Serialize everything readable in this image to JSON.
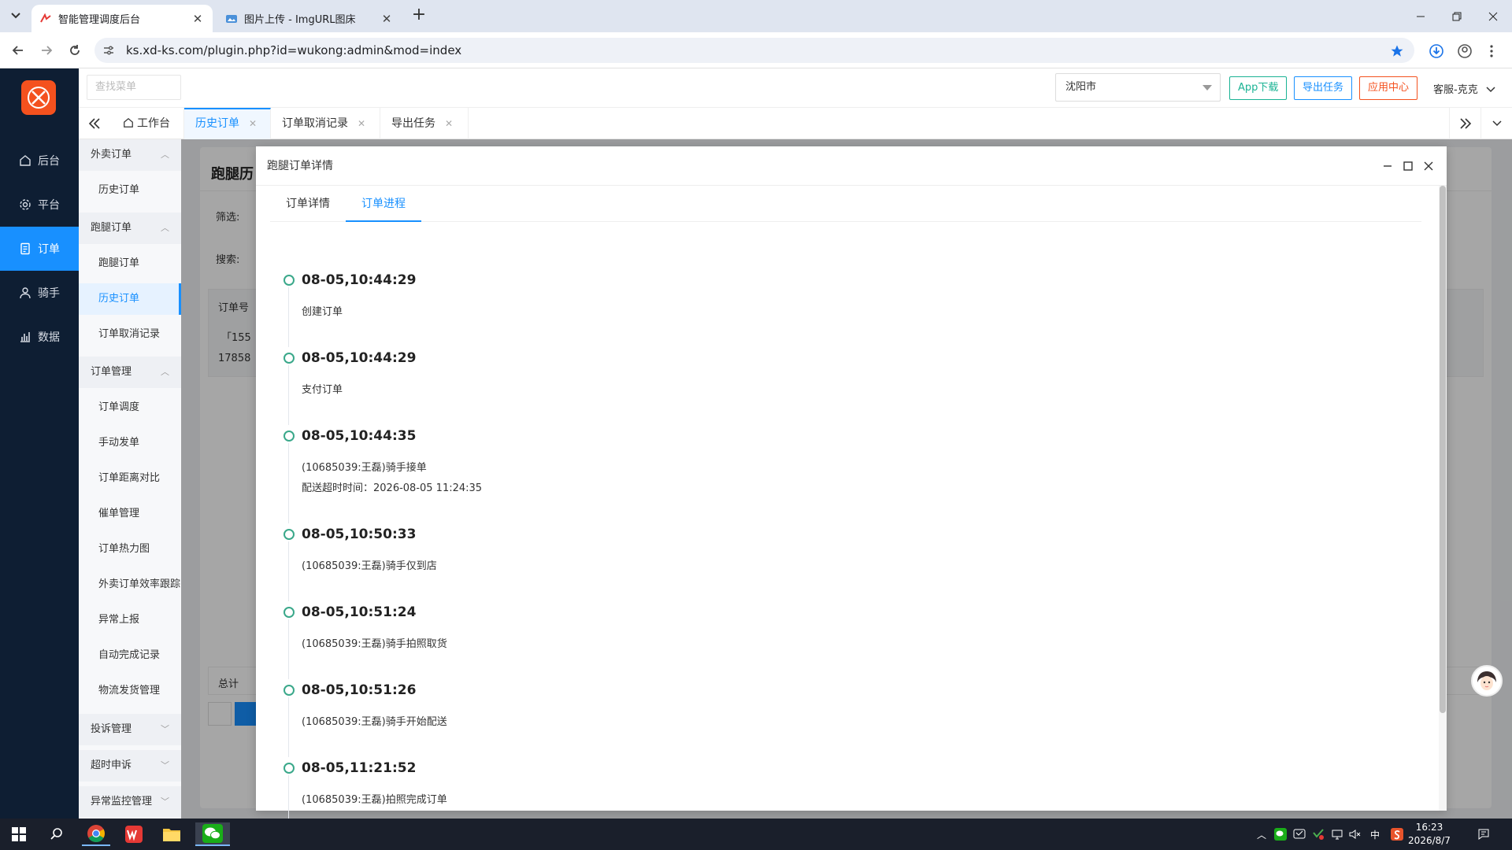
{
  "browser": {
    "tabs": [
      {
        "title": "智能管理调度后台",
        "active": true
      },
      {
        "title": "图片上传 - ImgURL图床",
        "active": false
      }
    ],
    "url": "ks.xd-ks.com/plugin.php?id=wukong:admin&mod=index"
  },
  "nav": {
    "items": [
      {
        "label": "后台",
        "icon": "home-icon",
        "active": false
      },
      {
        "label": "平台",
        "icon": "gear-icon",
        "active": false
      },
      {
        "label": "订单",
        "icon": "document-icon",
        "active": true
      },
      {
        "label": "骑手",
        "icon": "user-icon",
        "active": false
      },
      {
        "label": "数据",
        "icon": "bar-chart-icon",
        "active": false
      }
    ]
  },
  "topbar": {
    "search_placeholder": "查找菜单",
    "city": "沈阳市",
    "app_download": "App下载",
    "export_task": "导出任务",
    "app_center": "应用中心",
    "user": "客服-克克",
    "accent": "#1890ff",
    "danger": "#f4511e"
  },
  "pagetabs": {
    "items": [
      {
        "label": "工作台",
        "closable": false
      },
      {
        "label": "历史订单",
        "closable": true,
        "active": true
      },
      {
        "label": "订单取消记录",
        "closable": true
      },
      {
        "label": "导出任务",
        "closable": true
      }
    ]
  },
  "submenu": {
    "groups": [
      {
        "label": "外卖订单",
        "expanded": true,
        "items": [
          "历史订单"
        ]
      },
      {
        "label": "跑腿订单",
        "expanded": true,
        "items": [
          "跑腿订单",
          "历史订单",
          "订单取消记录"
        ],
        "active_item": "历史订单"
      },
      {
        "label": "订单管理",
        "expanded": true,
        "items": [
          "订单调度",
          "手动发单",
          "订单距离对比",
          "催单管理",
          "订单热力图",
          "外卖订单效率跟踪",
          "异常上报",
          "自动完成记录",
          "物流发货管理"
        ]
      },
      {
        "label": "投诉管理",
        "expanded": false,
        "items": []
      },
      {
        "label": "超时申诉",
        "expanded": false,
        "items": []
      },
      {
        "label": "异常监控管理",
        "expanded": false,
        "items": []
      }
    ]
  },
  "background": {
    "title": "跑腿历",
    "filter_label": "筛选:",
    "search_label": "搜索:",
    "col_order": "订单号",
    "row_1": "「155",
    "row_2": "17858",
    "total": "总计"
  },
  "modal": {
    "title": "跑腿订单详情",
    "tabs": [
      "订单详情",
      "订单进程"
    ],
    "active_tab": 1,
    "timeline": [
      {
        "time": "08-05,10:44:29",
        "lines": [
          "创建订单"
        ]
      },
      {
        "time": "08-05,10:44:29",
        "lines": [
          "支付订单"
        ]
      },
      {
        "time": "08-05,10:44:35",
        "lines": [
          "(10685039:王磊)骑手接单",
          "配送超时时间：2026-08-05 11:24:35"
        ]
      },
      {
        "time": "08-05,10:50:33",
        "lines": [
          "(10685039:王磊)骑手仅到店"
        ]
      },
      {
        "time": "08-05,10:51:24",
        "lines": [
          "(10685039:王磊)骑手拍照取货"
        ]
      },
      {
        "time": "08-05,10:51:26",
        "lines": [
          "(10685039:王磊)骑手开始配送"
        ]
      },
      {
        "time": "08-05,11:21:52",
        "lines": [
          "(10685039:王磊)拍照完成订单"
        ]
      }
    ],
    "dot_color": "#3aa88a"
  },
  "taskbar": {
    "ime": "中",
    "time": "16:23",
    "date": "2026/8/7"
  }
}
